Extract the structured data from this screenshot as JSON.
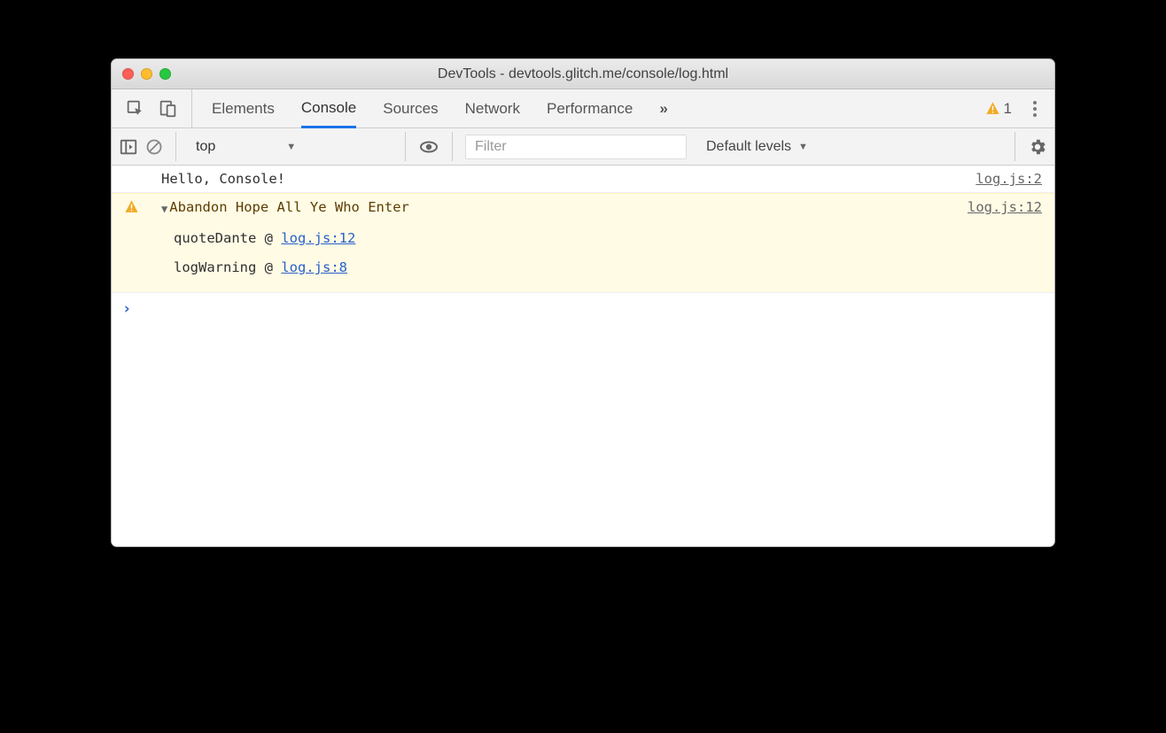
{
  "window": {
    "title": "DevTools - devtools.glitch.me/console/log.html"
  },
  "tabs": {
    "elements": "Elements",
    "console": "Console",
    "sources": "Sources",
    "network": "Network",
    "performance": "Performance",
    "overflow": "»",
    "warning_count": "1"
  },
  "toolbar": {
    "context": "top",
    "filter_placeholder": "Filter",
    "levels": "Default levels"
  },
  "messages": {
    "log1_text": "Hello, Console!",
    "log1_src": "log.js:2",
    "warn1_text": "Abandon Hope All Ye Who Enter",
    "warn1_src": "log.js:12",
    "stack": {
      "f0_name": "quoteDante",
      "f0_at": " @ ",
      "f0_loc": "log.js:12",
      "f1_name": "logWarning",
      "f1_at": " @ ",
      "f1_loc": "log.js:8"
    }
  },
  "prompt": "›"
}
